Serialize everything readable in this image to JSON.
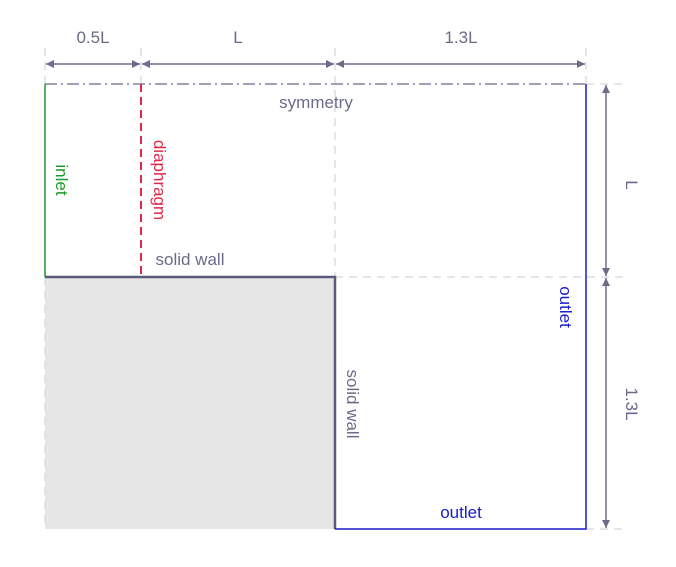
{
  "dimensions": {
    "top": [
      "0.5L",
      "L",
      "1.3L"
    ],
    "right": [
      "L",
      "1.3L"
    ]
  },
  "boundaries": {
    "symmetry": "symmetry",
    "inlet": "inlet",
    "diaphragm": "diaphragm",
    "solid_wall_horizontal": "solid wall",
    "solid_wall_vertical": "solid wall",
    "outlet_right": "outlet",
    "outlet_bottom": "outlet"
  },
  "colors": {
    "dimension": "#6b6b8a",
    "inlet": "#1a9a2a",
    "diaphragm": "#e0284a",
    "outlet": "#1a1acc",
    "wall": "#5a5a7a",
    "solid_fill": "#e6e6e6",
    "guide": "#dddddd"
  }
}
